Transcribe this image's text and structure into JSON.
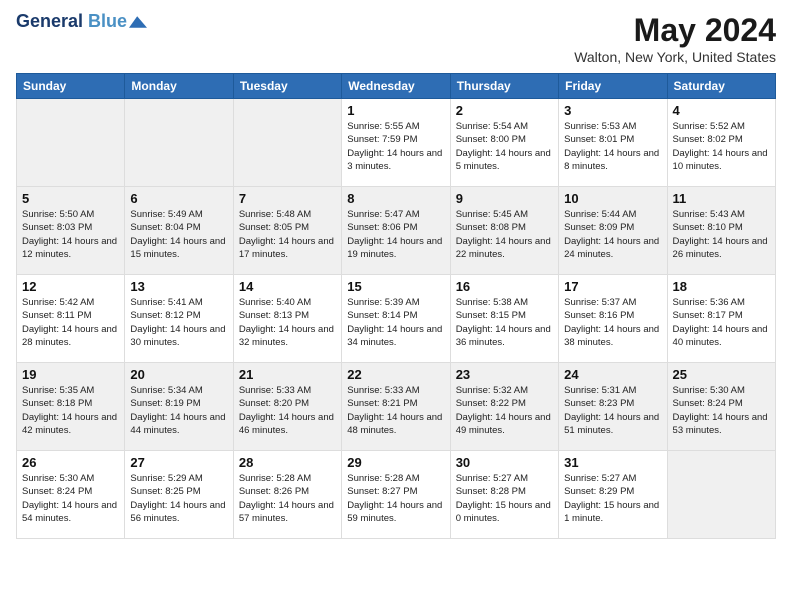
{
  "header": {
    "logo_line1": "General",
    "logo_line2": "Blue",
    "month": "May 2024",
    "location": "Walton, New York, United States"
  },
  "weekdays": [
    "Sunday",
    "Monday",
    "Tuesday",
    "Wednesday",
    "Thursday",
    "Friday",
    "Saturday"
  ],
  "weeks": [
    [
      null,
      null,
      null,
      {
        "day": 1,
        "sunrise": "5:55 AM",
        "sunset": "7:59 PM",
        "daylight": "14 hours and 3 minutes."
      },
      {
        "day": 2,
        "sunrise": "5:54 AM",
        "sunset": "8:00 PM",
        "daylight": "14 hours and 5 minutes."
      },
      {
        "day": 3,
        "sunrise": "5:53 AM",
        "sunset": "8:01 PM",
        "daylight": "14 hours and 8 minutes."
      },
      {
        "day": 4,
        "sunrise": "5:52 AM",
        "sunset": "8:02 PM",
        "daylight": "14 hours and 10 minutes."
      }
    ],
    [
      {
        "day": 5,
        "sunrise": "5:50 AM",
        "sunset": "8:03 PM",
        "daylight": "14 hours and 12 minutes."
      },
      {
        "day": 6,
        "sunrise": "5:49 AM",
        "sunset": "8:04 PM",
        "daylight": "14 hours and 15 minutes."
      },
      {
        "day": 7,
        "sunrise": "5:48 AM",
        "sunset": "8:05 PM",
        "daylight": "14 hours and 17 minutes."
      },
      {
        "day": 8,
        "sunrise": "5:47 AM",
        "sunset": "8:06 PM",
        "daylight": "14 hours and 19 minutes."
      },
      {
        "day": 9,
        "sunrise": "5:45 AM",
        "sunset": "8:08 PM",
        "daylight": "14 hours and 22 minutes."
      },
      {
        "day": 10,
        "sunrise": "5:44 AM",
        "sunset": "8:09 PM",
        "daylight": "14 hours and 24 minutes."
      },
      {
        "day": 11,
        "sunrise": "5:43 AM",
        "sunset": "8:10 PM",
        "daylight": "14 hours and 26 minutes."
      }
    ],
    [
      {
        "day": 12,
        "sunrise": "5:42 AM",
        "sunset": "8:11 PM",
        "daylight": "14 hours and 28 minutes."
      },
      {
        "day": 13,
        "sunrise": "5:41 AM",
        "sunset": "8:12 PM",
        "daylight": "14 hours and 30 minutes."
      },
      {
        "day": 14,
        "sunrise": "5:40 AM",
        "sunset": "8:13 PM",
        "daylight": "14 hours and 32 minutes."
      },
      {
        "day": 15,
        "sunrise": "5:39 AM",
        "sunset": "8:14 PM",
        "daylight": "14 hours and 34 minutes."
      },
      {
        "day": 16,
        "sunrise": "5:38 AM",
        "sunset": "8:15 PM",
        "daylight": "14 hours and 36 minutes."
      },
      {
        "day": 17,
        "sunrise": "5:37 AM",
        "sunset": "8:16 PM",
        "daylight": "14 hours and 38 minutes."
      },
      {
        "day": 18,
        "sunrise": "5:36 AM",
        "sunset": "8:17 PM",
        "daylight": "14 hours and 40 minutes."
      }
    ],
    [
      {
        "day": 19,
        "sunrise": "5:35 AM",
        "sunset": "8:18 PM",
        "daylight": "14 hours and 42 minutes."
      },
      {
        "day": 20,
        "sunrise": "5:34 AM",
        "sunset": "8:19 PM",
        "daylight": "14 hours and 44 minutes."
      },
      {
        "day": 21,
        "sunrise": "5:33 AM",
        "sunset": "8:20 PM",
        "daylight": "14 hours and 46 minutes."
      },
      {
        "day": 22,
        "sunrise": "5:33 AM",
        "sunset": "8:21 PM",
        "daylight": "14 hours and 48 minutes."
      },
      {
        "day": 23,
        "sunrise": "5:32 AM",
        "sunset": "8:22 PM",
        "daylight": "14 hours and 49 minutes."
      },
      {
        "day": 24,
        "sunrise": "5:31 AM",
        "sunset": "8:23 PM",
        "daylight": "14 hours and 51 minutes."
      },
      {
        "day": 25,
        "sunrise": "5:30 AM",
        "sunset": "8:24 PM",
        "daylight": "14 hours and 53 minutes."
      }
    ],
    [
      {
        "day": 26,
        "sunrise": "5:30 AM",
        "sunset": "8:24 PM",
        "daylight": "14 hours and 54 minutes."
      },
      {
        "day": 27,
        "sunrise": "5:29 AM",
        "sunset": "8:25 PM",
        "daylight": "14 hours and 56 minutes."
      },
      {
        "day": 28,
        "sunrise": "5:28 AM",
        "sunset": "8:26 PM",
        "daylight": "14 hours and 57 minutes."
      },
      {
        "day": 29,
        "sunrise": "5:28 AM",
        "sunset": "8:27 PM",
        "daylight": "14 hours and 59 minutes."
      },
      {
        "day": 30,
        "sunrise": "5:27 AM",
        "sunset": "8:28 PM",
        "daylight": "15 hours and 0 minutes."
      },
      {
        "day": 31,
        "sunrise": "5:27 AM",
        "sunset": "8:29 PM",
        "daylight": "15 hours and 1 minute."
      },
      null
    ]
  ],
  "labels": {
    "sunrise": "Sunrise:",
    "sunset": "Sunset:",
    "daylight": "Daylight:"
  }
}
